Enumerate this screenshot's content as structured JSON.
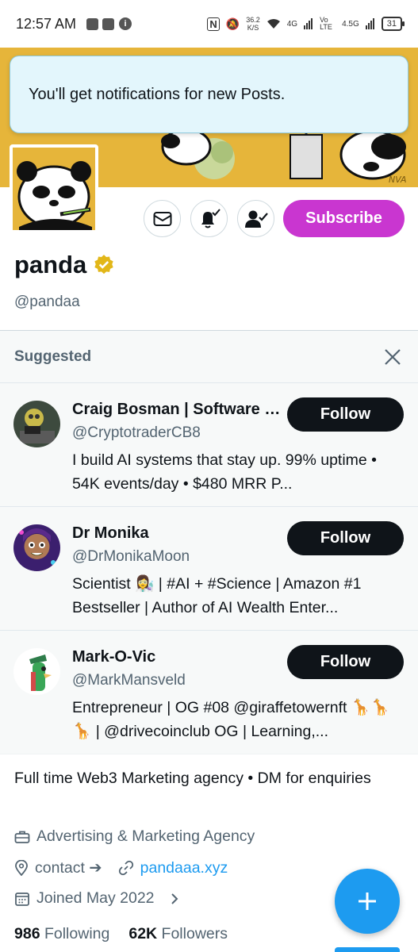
{
  "status_bar": {
    "time": "12:57 AM",
    "net_speed_value": "36.2",
    "net_speed_unit": "K/S",
    "network_1": "4G",
    "volte": "Vo LTE",
    "network_2": "4.5G",
    "battery": "31"
  },
  "toast": {
    "message": "You'll get notifications for new Posts."
  },
  "banner": {
    "signature": "NVA"
  },
  "profile": {
    "name": "panda",
    "handle": "@pandaa",
    "subscribe_label": "Subscribe",
    "bio": "Full time Web3 Marketing agency • DM for enquiries",
    "category": "Advertising & Marketing Agency",
    "location": "contact ➔",
    "website": "pandaaa.xyz",
    "joined": "Joined May 2022",
    "following_count": "986",
    "following_label": "Following",
    "followers_count": "62K",
    "followers_label": "Followers"
  },
  "suggested": {
    "title": "Suggested",
    "items": [
      {
        "name": "Craig Bosman | Software Engineer",
        "handle": "@CryptotraderCB8",
        "bio": "I build AI systems that stay up. 99% uptime • 54K events/day • $480 MRR P...",
        "follow_label": "Follow"
      },
      {
        "name": "Dr Monika",
        "handle": "@DrMonikaMoon",
        "bio": "Scientist 👩‍🔬 | #AI + #Science | Amazon #1 Bestseller | Author of AI Wealth Enter...",
        "follow_label": "Follow"
      },
      {
        "name": "Mark-O-Vic",
        "handle": "@MarkMansveld",
        "bio": "Entrepreneur | OG #08 @giraffetowernft 🦒🦒🦒 | @drivecoinclub OG | Learning,...",
        "follow_label": "Follow"
      }
    ]
  },
  "icons": [
    "mail-icon",
    "bell-check-icon",
    "person-check-icon",
    "verified-badge-icon",
    "close-icon",
    "briefcase-icon",
    "location-icon",
    "link-icon",
    "calendar-icon",
    "chevron-right-icon",
    "plus-icon"
  ],
  "colors": {
    "accent": "#1d9bf0",
    "subscribe": "#c936d0",
    "verified": "#e2b719",
    "banner": "#e6b53a",
    "toast_bg": "#e3f6fc"
  }
}
